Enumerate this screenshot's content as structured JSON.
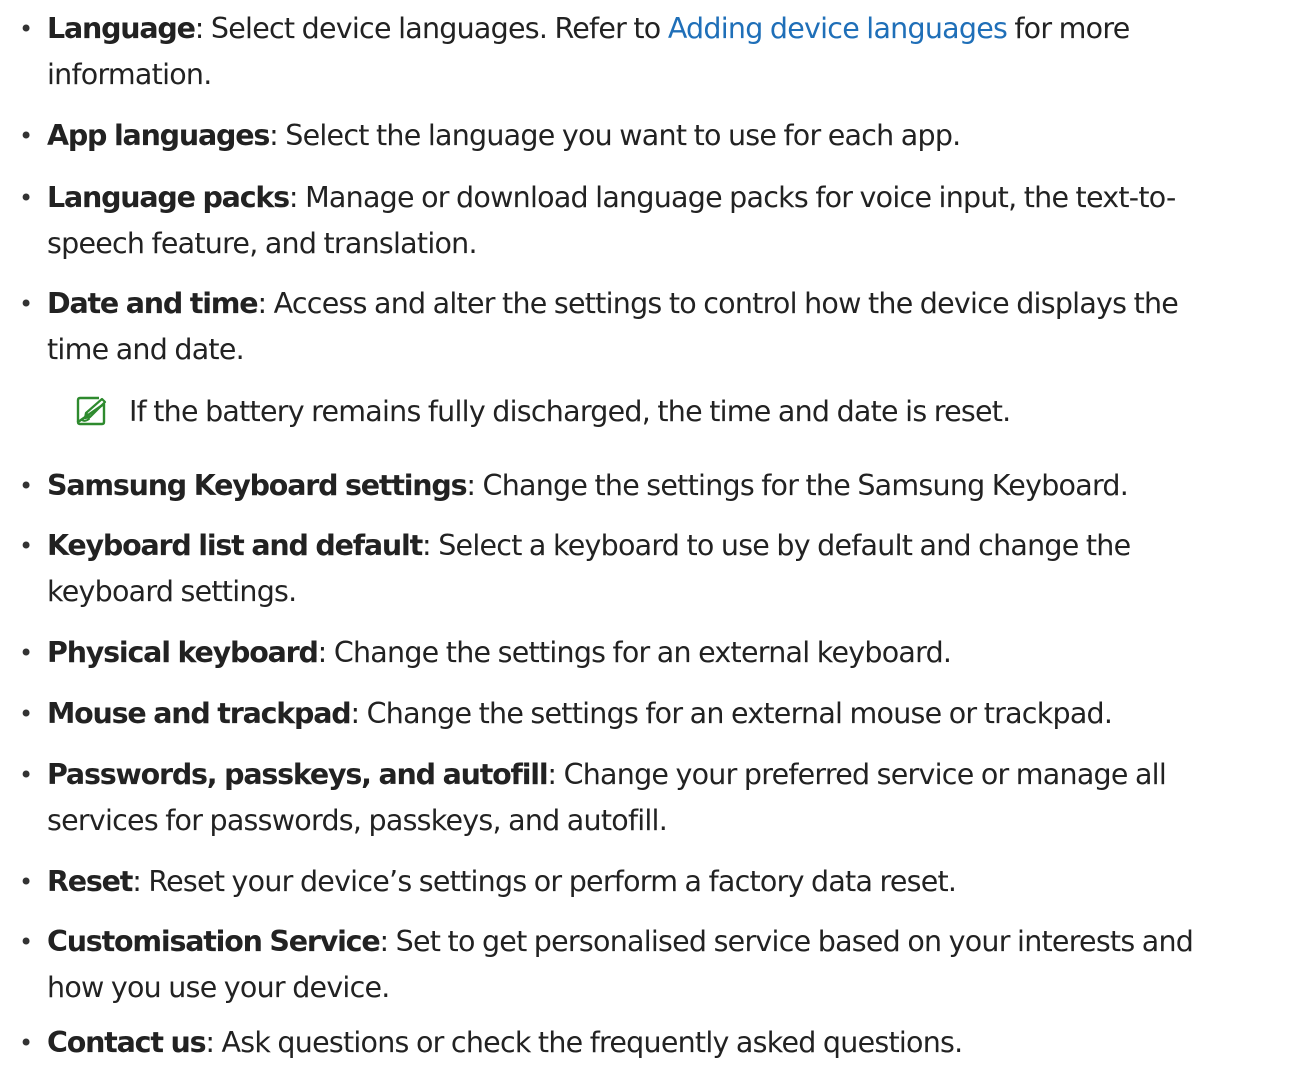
{
  "items": [
    {
      "term": "Language",
      "lines": [
        {
          "before": "Select device languages. Refer to ",
          "link": "Adding device languages",
          "after": " for more"
        },
        "information."
      ]
    },
    {
      "term": "App languages",
      "lines": [
        "Select the language you want to use for each app."
      ]
    },
    {
      "term": "Language packs",
      "lines": [
        "Manage or download language packs for voice input, the text-to-",
        "speech feature, and translation."
      ]
    },
    {
      "term": "Date and time",
      "lines": [
        "Access and alter the settings to control how the device displays the",
        "time and date."
      ]
    },
    {
      "term": "Samsung Keyboard settings",
      "lines": [
        "Change the settings for the Samsung Keyboard."
      ]
    },
    {
      "term": "Keyboard list and default",
      "lines": [
        "Select a keyboard to use by default and change the",
        "keyboard settings."
      ]
    },
    {
      "term": "Physical keyboard",
      "lines": [
        "Change the settings for an external keyboard."
      ]
    },
    {
      "term": "Mouse and trackpad",
      "lines": [
        "Change the settings for an external mouse or trackpad."
      ]
    },
    {
      "term": "Passwords, passkeys, and autofill",
      "lines": [
        "Change your preferred service or manage all",
        "services for passwords, passkeys, and autofill."
      ]
    },
    {
      "term": "Reset",
      "lines": [
        "Reset your device’s settings or perform a factory data reset."
      ]
    },
    {
      "term": "Customisation Service",
      "lines": [
        "Set to get personalised service based on your interests and",
        "how you use your device."
      ]
    },
    {
      "term": "Contact us",
      "lines": [
        "Ask questions or check the frequently asked questions."
      ]
    }
  ],
  "note": {
    "icon": "note-pencil-icon",
    "text": "If the battery remains fully discharged, the time and date is reset."
  },
  "colors": {
    "link": "#1f6fb8",
    "text": "#222222",
    "icon": "#2e8a2e"
  },
  "bullet_char": "•",
  "separator": ": "
}
